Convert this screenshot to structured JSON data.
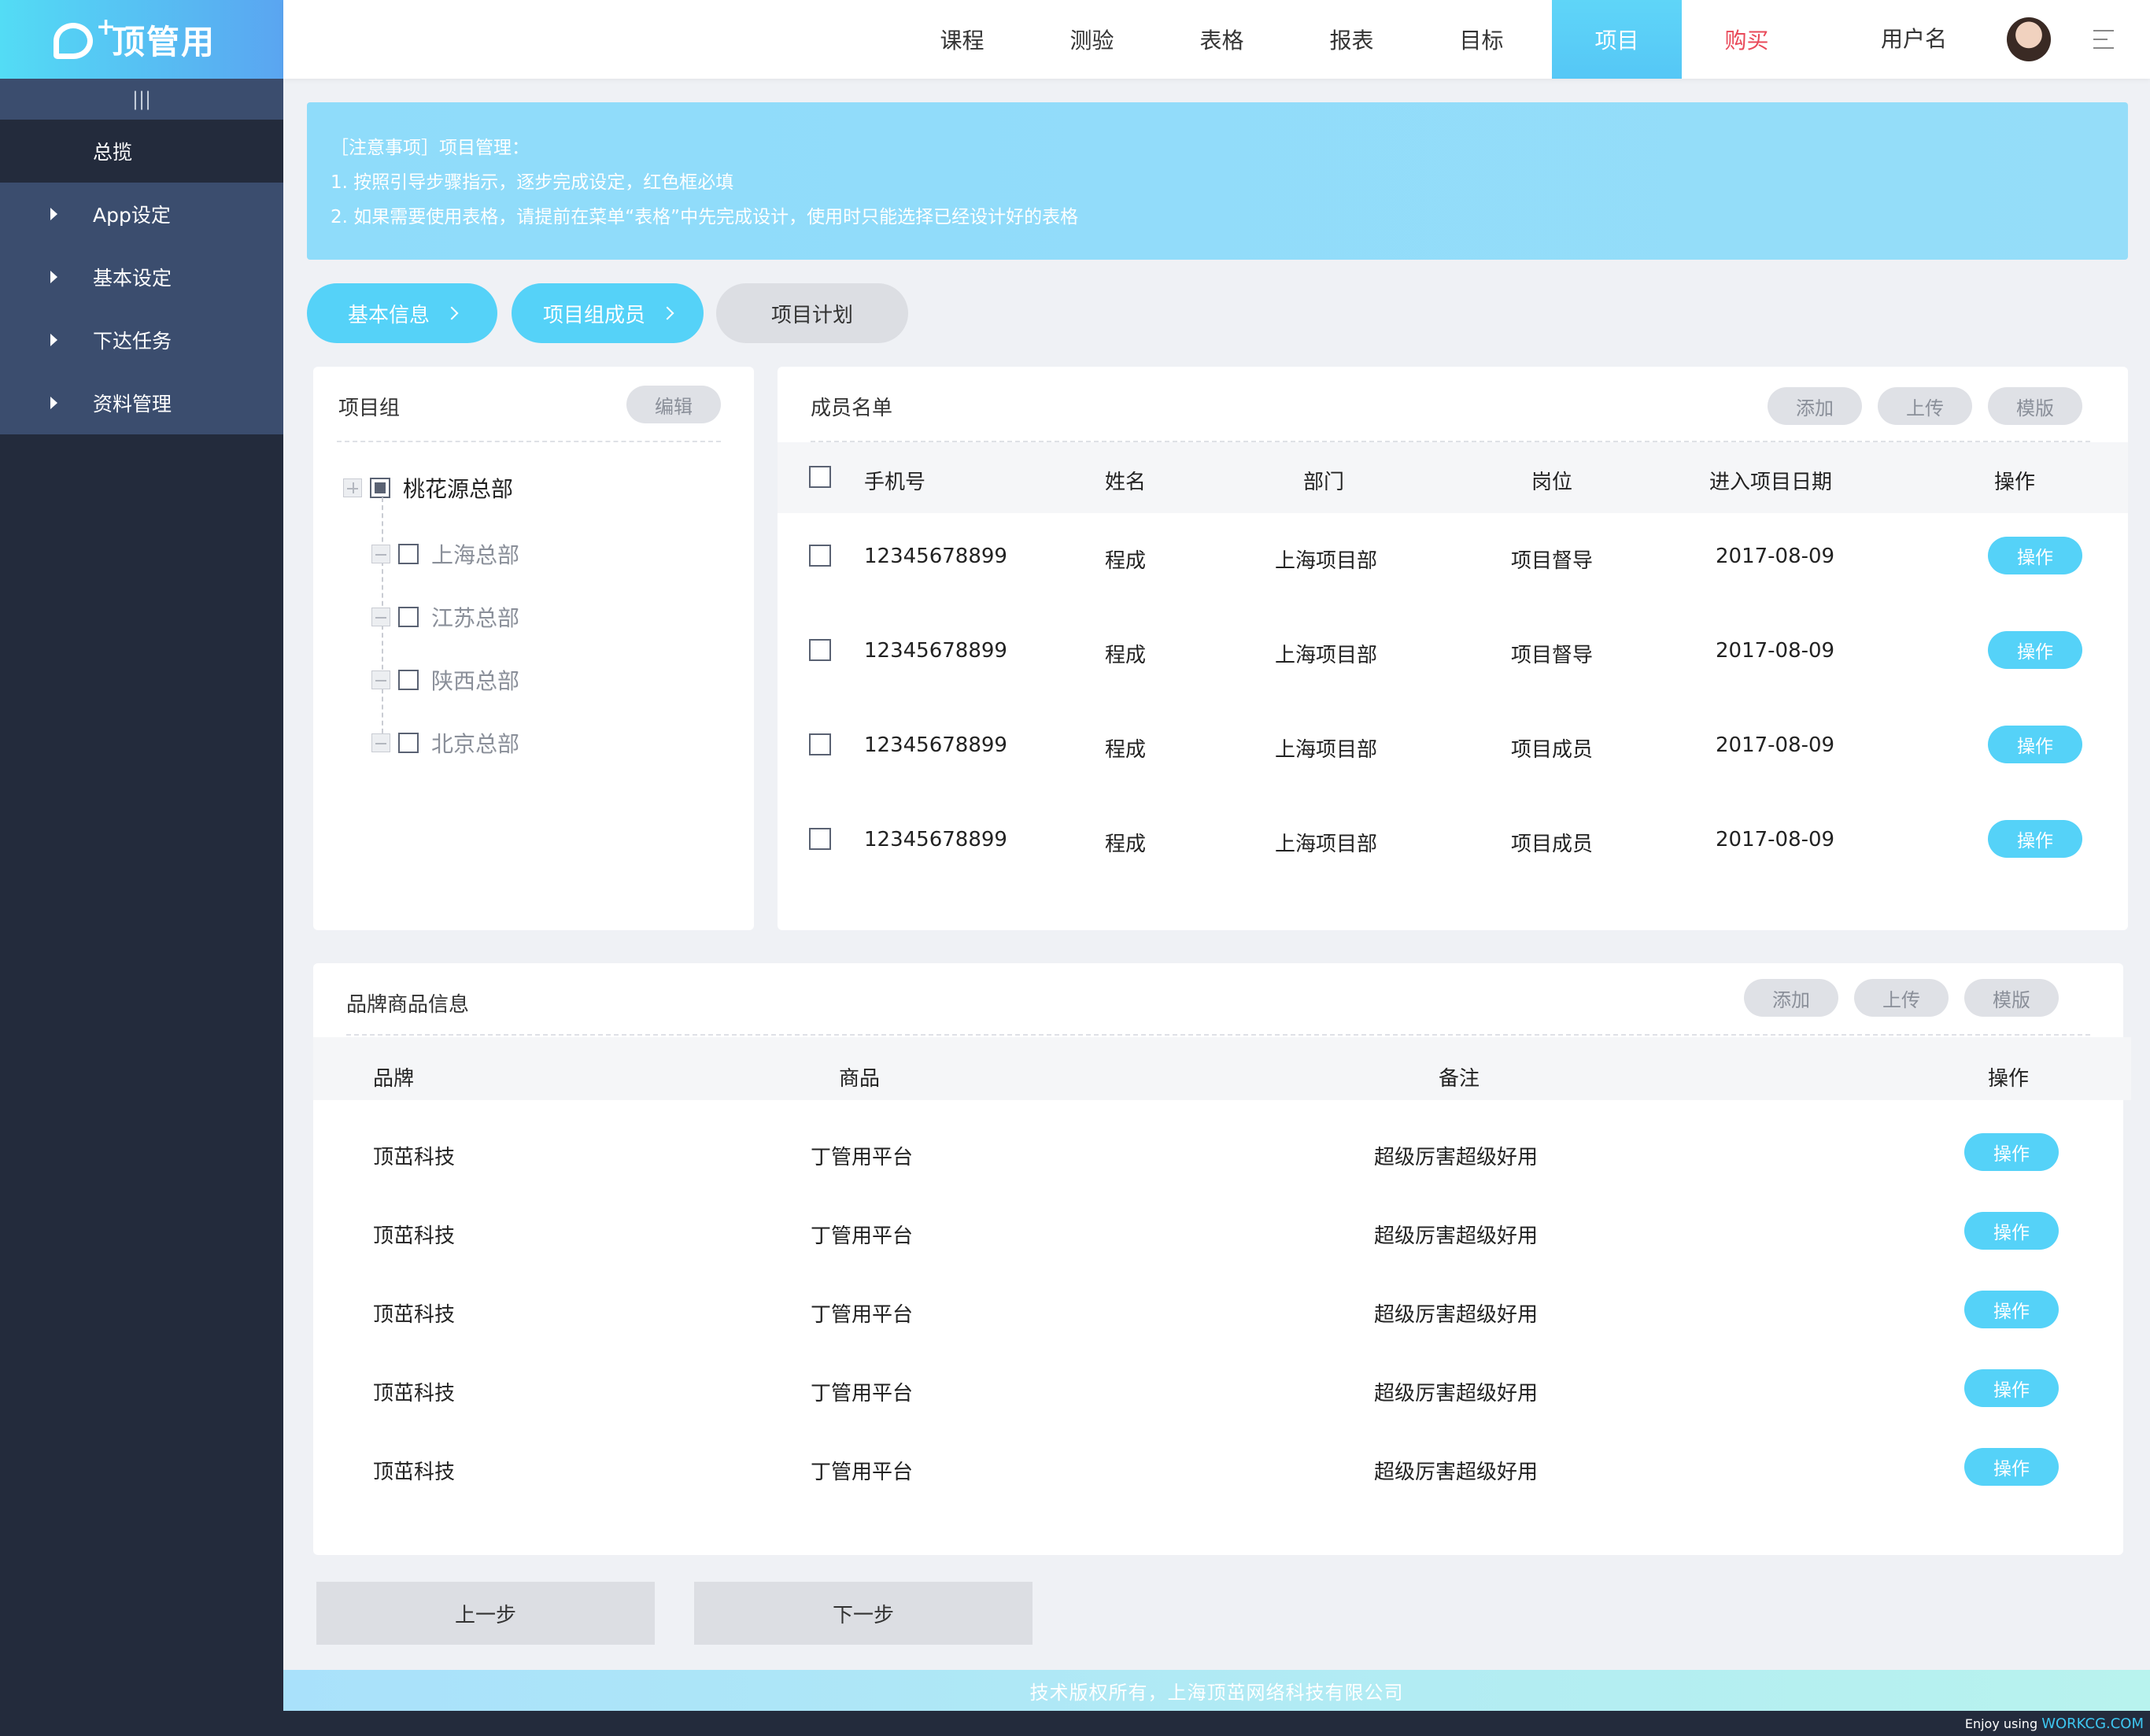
{
  "brand": {
    "logo_text": "顶管用",
    "logo_plus": "+"
  },
  "sidebar": {
    "collapse_icon": "|||",
    "items": [
      {
        "label": "总揽",
        "active": true
      },
      {
        "label": "App设定"
      },
      {
        "label": "基本设定"
      },
      {
        "label": "下达任务"
      },
      {
        "label": "资料管理"
      }
    ]
  },
  "topnav": {
    "items": [
      "课程",
      "测验",
      "表格",
      "报表",
      "目标",
      "项目",
      "购买"
    ],
    "active": "项目",
    "username": "用户名"
  },
  "notice": {
    "line1": "［注意事项］项目管理：",
    "line2": "1. 按照引导步骤指示，逐步完成设定，红色框必填",
    "line3": "2. 如果需要使用表格，请提前在菜单“表格”中先完成设计，使用时只能选择已经设计好的表格"
  },
  "steps": [
    "基本信息",
    "项目组成员",
    "项目计划"
  ],
  "project_group": {
    "title": "项目组",
    "edit_label": "编辑",
    "root": "桃花源总部",
    "children": [
      "上海总部",
      "江苏总部",
      "陕西总部",
      "北京总部"
    ]
  },
  "members": {
    "title": "成员名单",
    "actions": [
      "添加",
      "上传",
      "模版"
    ],
    "columns": [
      "手机号",
      "姓名",
      "部门",
      "岗位",
      "进入项目日期",
      "操作"
    ],
    "rows": [
      [
        "12345678899",
        "程成",
        "上海项目部",
        "项目督导",
        "2017-08-09",
        "操作"
      ],
      [
        "12345678899",
        "程成",
        "上海项目部",
        "项目督导",
        "2017-08-09",
        "操作"
      ],
      [
        "12345678899",
        "程成",
        "上海项目部",
        "项目成员",
        "2017-08-09",
        "操作"
      ],
      [
        "12345678899",
        "程成",
        "上海项目部",
        "项目成员",
        "2017-08-09",
        "操作"
      ]
    ]
  },
  "brands": {
    "title": "品牌商品信息",
    "actions": [
      "添加",
      "上传",
      "模版"
    ],
    "columns": [
      "品牌",
      "商品",
      "备注",
      "操作"
    ],
    "rows": [
      [
        "顶茁科技",
        "丁管用平台",
        "超级厉害超级好用",
        "操作"
      ],
      [
        "顶茁科技",
        "丁管用平台",
        "超级厉害超级好用",
        "操作"
      ],
      [
        "顶茁科技",
        "丁管用平台",
        "超级厉害超级好用",
        "操作"
      ],
      [
        "顶茁科技",
        "丁管用平台",
        "超级厉害超级好用",
        "操作"
      ],
      [
        "顶茁科技",
        "丁管用平台",
        "超级厉害超级好用",
        "操作"
      ]
    ]
  },
  "buttons": {
    "prev": "上一步",
    "next": "下一步"
  },
  "footer": "技术版权所有，上海顶茁网络科技有限公司",
  "credit": {
    "prefix": "Enjoy using",
    "brand": "WORKCG.COM"
  },
  "colors": {
    "accent": "#55d2f8",
    "sidebar": "#232b3c",
    "sidebar_item": "#3b4d6e",
    "buy": "#e94a5a"
  }
}
